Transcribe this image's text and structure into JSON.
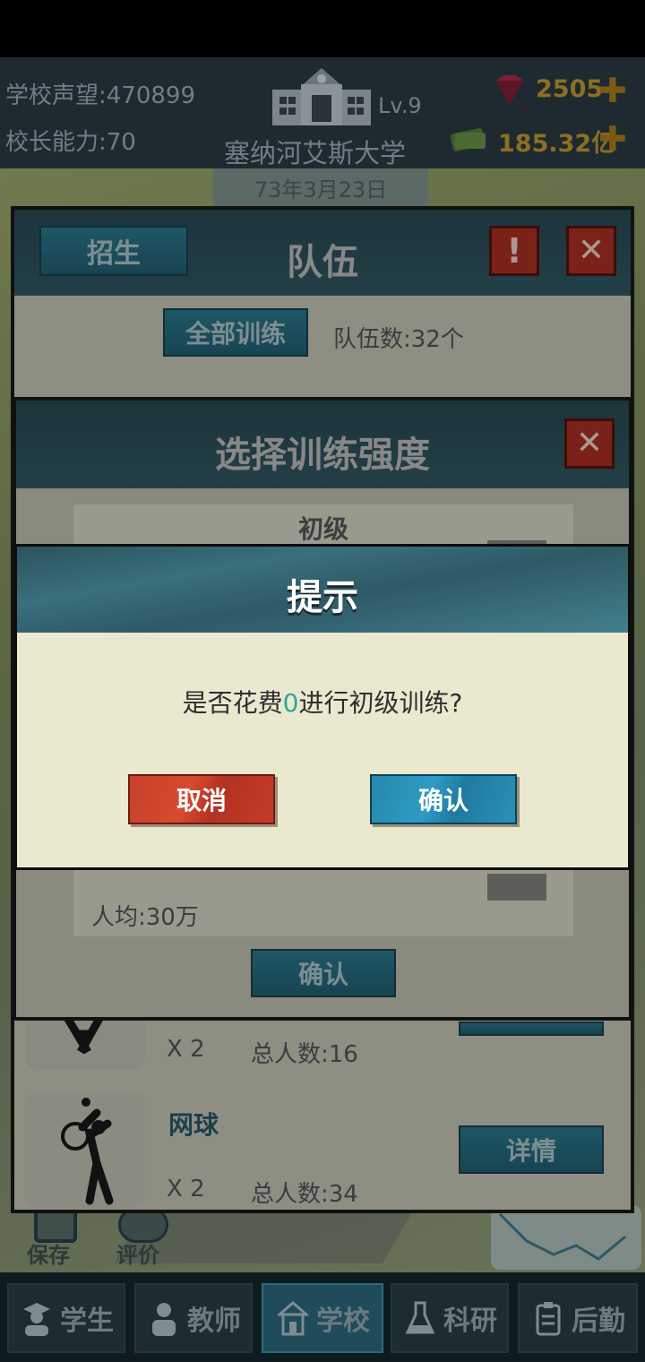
{
  "hud": {
    "reputation_label": "学校声望:",
    "reputation_value": "470899",
    "ability_label": "校长能力:",
    "ability_value": "70",
    "level": "Lv.9",
    "school_name": "塞纳河艾斯大学",
    "gems": "2505",
    "money": "185.32亿",
    "date": "73年3月23日"
  },
  "team_panel": {
    "recruit_button": "招生",
    "title": "队伍",
    "train_all_button": "全部训练",
    "team_count": "队伍数:32个",
    "rows": [
      {
        "multiplier": "X 2",
        "total": "总人数:16"
      },
      {
        "name": "网球",
        "multiplier": "X 2",
        "total": "总人数:34",
        "details_button": "详情"
      }
    ]
  },
  "intensity_panel": {
    "title": "选择训练强度",
    "level_label": "初级",
    "per_capita": "人均:30万",
    "confirm_button": "确认"
  },
  "dialog": {
    "title": "提示",
    "message_prefix": "是否花费",
    "message_cost": "0",
    "message_suffix": "进行初级训练?",
    "cancel_button": "取消",
    "confirm_button": "确认"
  },
  "map_buttons": {
    "save": "保存",
    "rate": "评价"
  },
  "nav": {
    "tabs": [
      {
        "label": "学生",
        "icon": "student-icon"
      },
      {
        "label": "教师",
        "icon": "teacher-icon"
      },
      {
        "label": "学校",
        "icon": "school-icon"
      },
      {
        "label": "科研",
        "icon": "flask-icon"
      },
      {
        "label": "后勤",
        "icon": "clipboard-icon"
      }
    ],
    "active": "学校"
  },
  "colors": {
    "dialog_header": "#3a6f7c",
    "dialog_body": "#ebe8d0",
    "cancel": "#c8402a",
    "confirm": "#2e9bc3",
    "highlight": "#2fa79b"
  }
}
